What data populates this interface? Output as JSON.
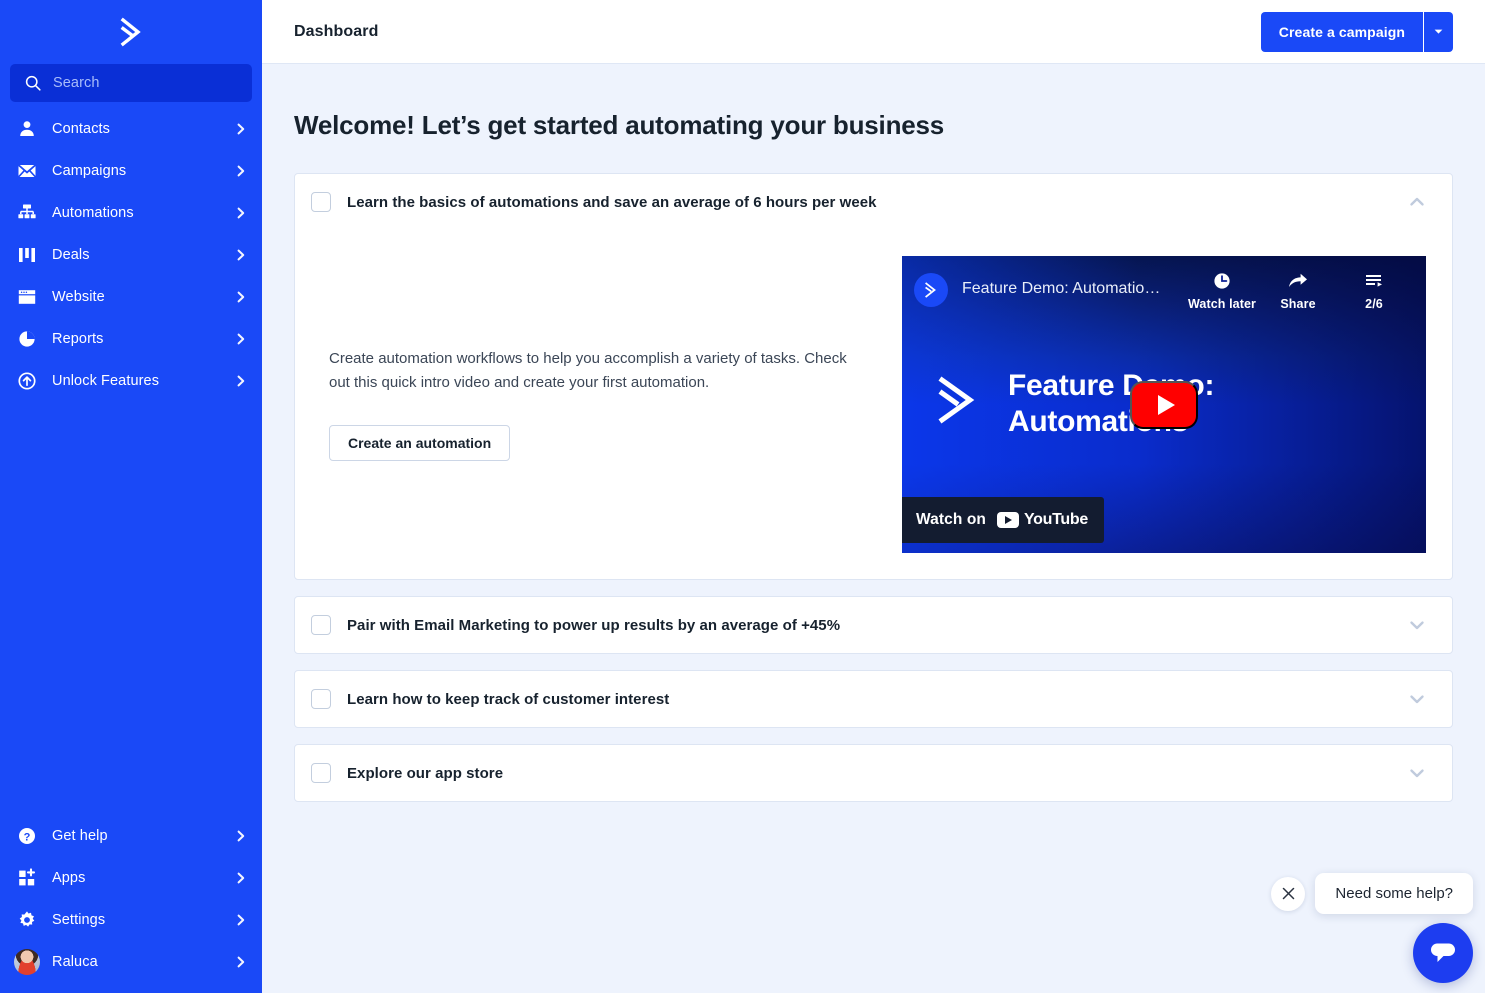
{
  "brand": {
    "logo_icon": "activecampaign-chevron-logo",
    "sidebar_color": "#1a49f7",
    "accent_color": "#1a49f7",
    "page_bg": "#eef3fd"
  },
  "sidebar": {
    "search": {
      "placeholder": "Search",
      "value": "",
      "icon": "search-icon"
    },
    "top_items": [
      {
        "label": "Contacts",
        "icon": "person-icon"
      },
      {
        "label": "Campaigns",
        "icon": "envelope-icon"
      },
      {
        "label": "Automations",
        "icon": "sitemap-icon"
      },
      {
        "label": "Deals",
        "icon": "kanban-columns-icon"
      },
      {
        "label": "Website",
        "icon": "browser-window-icon"
      },
      {
        "label": "Reports",
        "icon": "pie-chart-icon"
      },
      {
        "label": "Unlock Features",
        "icon": "arrow-up-circle-icon"
      }
    ],
    "bottom_items": [
      {
        "label": "Get help",
        "icon": "question-circle-icon"
      },
      {
        "label": "Apps",
        "icon": "grid-plus-icon"
      },
      {
        "label": "Settings",
        "icon": "gear-icon"
      },
      {
        "label": "Raluca",
        "icon": "user-avatar"
      }
    ]
  },
  "topbar": {
    "title": "Dashboard",
    "create_campaign_label": "Create a campaign",
    "caret_icon": "caret-down-icon"
  },
  "main": {
    "welcome_heading": "Welcome! Let’s get started automating your business",
    "cards": [
      {
        "title": "Learn the basics of automations and save an average of 6 hours per week",
        "expanded": true,
        "chevron_icon": "chevron-up-icon",
        "checked": false,
        "body_text": "Create automation workflows to help you accomplish a variety of tasks. Check out this quick intro video and create your first automation.",
        "cta_label": "Create an automation"
      },
      {
        "title": "Pair with Email Marketing to power up results by an average of +45%",
        "expanded": false,
        "chevron_icon": "chevron-down-icon",
        "checked": false
      },
      {
        "title": "Learn how to keep track of customer interest",
        "expanded": false,
        "chevron_icon": "chevron-down-icon",
        "checked": false
      },
      {
        "title": "Explore our app store",
        "expanded": false,
        "chevron_icon": "chevron-down-icon",
        "checked": false
      }
    ]
  },
  "video": {
    "channel_icon": "activecampaign-channel-avatar",
    "title": "Feature Demo: Automatio…",
    "watch_later_label": "Watch later",
    "watch_later_icon": "clock-icon",
    "share_label": "Share",
    "share_icon": "share-arrow-icon",
    "playlist_counter": "2/6",
    "playlist_icon": "playlist-icon",
    "hero_line1": "Feature Demo:",
    "hero_line2": "Automations",
    "hero_logo_icon": "activecampaign-chevron-logo",
    "play_icon": "youtube-play-button",
    "watch_on_label": "Watch on",
    "youtube_wordmark": "YouTube"
  },
  "chat": {
    "message": "Need some help?",
    "close_icon": "close-icon",
    "launcher_icon": "chat-bubble-icon"
  }
}
